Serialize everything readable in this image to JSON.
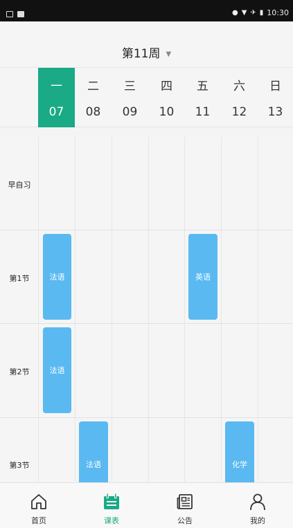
{
  "status_bar": {
    "time": "10:30"
  },
  "header": {
    "week_title": "第11周"
  },
  "days": [
    {
      "name": "一",
      "date": "07",
      "active": true
    },
    {
      "name": "二",
      "date": "08",
      "active": false
    },
    {
      "name": "三",
      "date": "09",
      "active": false
    },
    {
      "name": "四",
      "date": "10",
      "active": false
    },
    {
      "name": "五",
      "date": "11",
      "active": false
    },
    {
      "name": "六",
      "date": "12",
      "active": false
    },
    {
      "name": "日",
      "date": "13",
      "active": false
    }
  ],
  "periods": [
    "早自习",
    "第1节",
    "第2节",
    "第3节"
  ],
  "courses": [
    {
      "name": "法语",
      "day": 1,
      "period": 2
    },
    {
      "name": "英语",
      "day": 5,
      "period": 2
    },
    {
      "name": "法语",
      "day": 1,
      "period": 3
    },
    {
      "name": "法语",
      "day": 2,
      "period": 4
    },
    {
      "name": "化学",
      "day": 6,
      "period": 4
    }
  ],
  "colors": {
    "accent": "#1aaa85",
    "course": "#5ab9f1"
  },
  "nav": [
    {
      "label": "首页",
      "icon": "home-icon",
      "active": false
    },
    {
      "label": "课表",
      "icon": "calendar-icon",
      "active": true
    },
    {
      "label": "公告",
      "icon": "newspaper-icon",
      "active": false
    },
    {
      "label": "我的",
      "icon": "user-icon",
      "active": false
    }
  ]
}
